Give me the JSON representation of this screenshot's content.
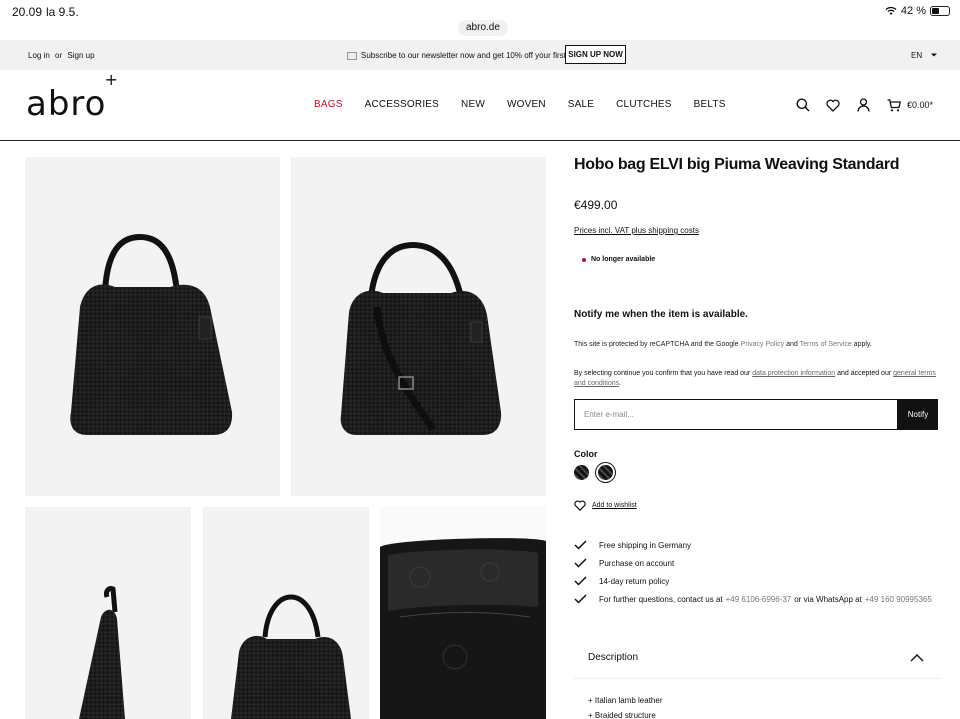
{
  "status_bar": {
    "time": "20.09",
    "date": "la 9.5.",
    "url": "abro.de",
    "battery": "42 %"
  },
  "top_bar": {
    "login": "Log in",
    "or": "or",
    "signup": "Sign up",
    "promo": "Subscribe to our newsletter now and get 10% off your first order!",
    "signup_button": "SIGN UP NOW",
    "language": "EN"
  },
  "header": {
    "logo": "abro",
    "logo_mark": "+",
    "nav": [
      "BAGS",
      "ACCESSORIES",
      "NEW",
      "WOVEN",
      "SALE",
      "CLUTCHES",
      "BELTS"
    ],
    "active_nav": "BAGS",
    "cart_total": "€0.00*"
  },
  "product": {
    "title": "Hobo bag ELVI big Piuma Weaving Standard",
    "price": "€499.00",
    "vat_note": "Prices incl. VAT plus shipping costs",
    "availability": "No longer available",
    "notify_heading": "Notify me when the item is available.",
    "recaptcha": {
      "prefix": "This site is protected by reCAPTCHA and the Google",
      "privacy": "Privacy Policy",
      "and": "and",
      "terms": "Terms of Service",
      "suffix": "apply."
    },
    "consent": {
      "prefix": "By selecting continue you confirm that you have read our",
      "link1": "data protection information",
      "middle": "and accepted our",
      "link2": "general terms and conditions",
      "suffix": "."
    },
    "email_placeholder": "Enter e-mail...",
    "notify_button": "Notify",
    "color_label": "Color",
    "wishlist": "Add to wishlist",
    "features": [
      "Free shipping in Germany",
      "Purchase on account",
      "14-day return policy"
    ],
    "contact": {
      "prefix": "For further questions, contact us at",
      "phone": "+49 6106-6996-37",
      "middle": "or via WhatsApp at",
      "whatsapp": "+49 160 90995365"
    },
    "description_label": "Description",
    "description_bullets": [
      "+ Italian lamb leather",
      "+ Braided structure"
    ]
  },
  "colors": {
    "accent": "#c0102a",
    "text": "#111111",
    "tile_bg": "#f3f3f3",
    "topbar_bg": "#f1f1f1"
  }
}
